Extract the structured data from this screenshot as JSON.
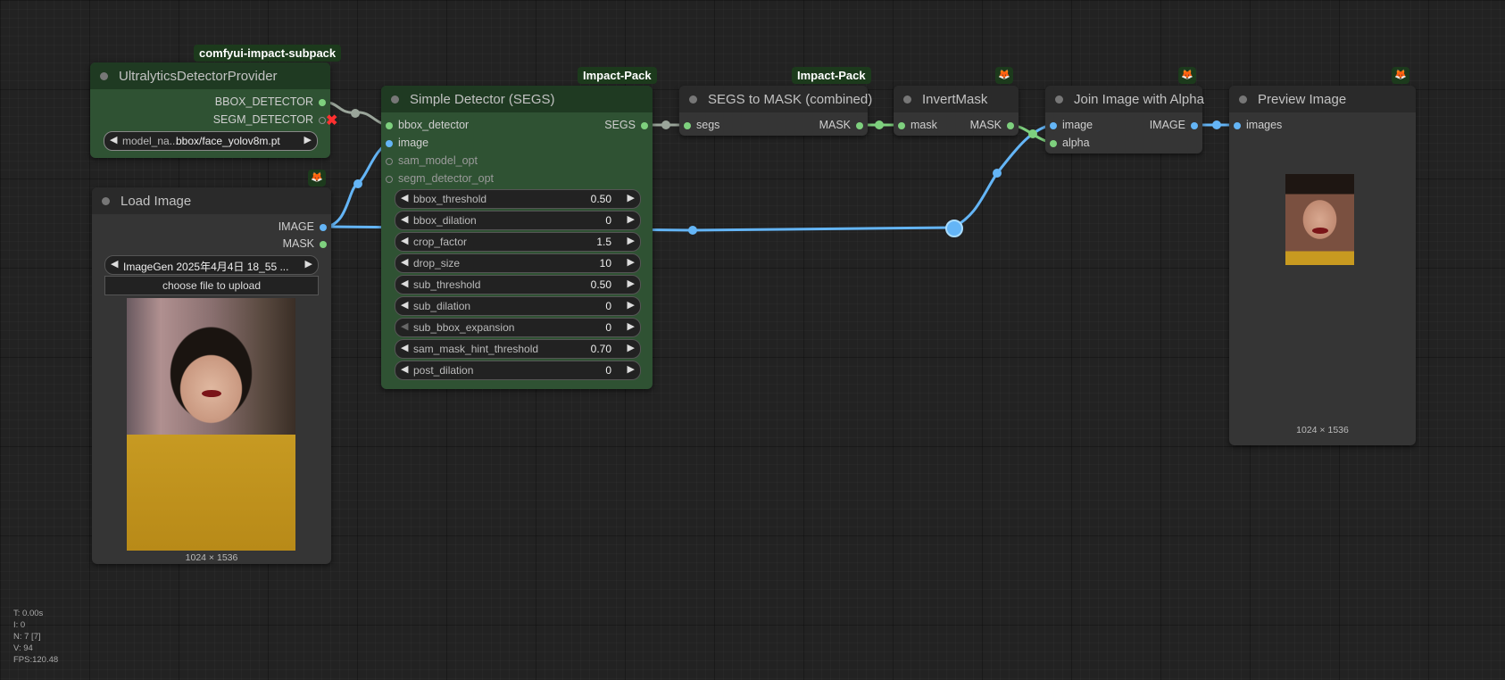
{
  "nodes": {
    "ultralytics": {
      "badge": "comfyui-impact-subpack",
      "title": "UltralyticsDetectorProvider",
      "outputs": [
        "BBOX_DETECTOR",
        "SEGM_DETECTOR"
      ],
      "widget_name": "model_na...",
      "widget_value": "bbox/face_yolov8m.pt",
      "segm_disconnected_icon": "red-x-icon"
    },
    "load_image": {
      "badge_icon": "fox-icon",
      "title": "Load Image",
      "outputs": [
        "IMAGE",
        "MASK"
      ],
      "file_value": "ImageGen 2025年4月4日 18_55 ...",
      "upload_label": "choose file to upload",
      "image_size": "1024 × 1536"
    },
    "simple_detector": {
      "badge": "Impact-Pack",
      "title": "Simple Detector (SEGS)",
      "inputs": [
        "bbox_detector",
        "image",
        "sam_model_opt",
        "segm_detector_opt"
      ],
      "outputs": [
        "SEGS"
      ],
      "widgets": [
        {
          "name": "bbox_threshold",
          "value": "0.50"
        },
        {
          "name": "bbox_dilation",
          "value": "0"
        },
        {
          "name": "crop_factor",
          "value": "1.5"
        },
        {
          "name": "drop_size",
          "value": "10"
        },
        {
          "name": "sub_threshold",
          "value": "0.50"
        },
        {
          "name": "sub_dilation",
          "value": "0"
        },
        {
          "name": "sub_bbox_expansion",
          "value": "0"
        },
        {
          "name": "sam_mask_hint_threshold",
          "value": "0.70"
        },
        {
          "name": "post_dilation",
          "value": "0"
        }
      ]
    },
    "segs_to_mask": {
      "badge": "Impact-Pack",
      "title": "SEGS to MASK (combined)",
      "inputs": [
        "segs"
      ],
      "outputs": [
        "MASK"
      ]
    },
    "invert_mask": {
      "badge_icon": "fox-icon",
      "title": "InvertMask",
      "inputs": [
        "mask"
      ],
      "outputs": [
        "MASK"
      ]
    },
    "join_alpha": {
      "badge_icon": "fox-icon",
      "title": "Join Image with Alpha",
      "inputs": [
        "image",
        "alpha"
      ],
      "outputs": [
        "IMAGE"
      ]
    },
    "preview": {
      "badge_icon": "fox-icon",
      "title": "Preview Image",
      "inputs": [
        "images"
      ],
      "image_size": "1024 × 1536"
    }
  },
  "hud": {
    "t": "T: 0.00s",
    "i": "I: 0",
    "n": "N: 7 [7]",
    "v": "V: 94",
    "fps": "FPS:120.48"
  },
  "colors": {
    "canvas": "#222222",
    "node_dark": "#353535",
    "node_green": "#2f5233",
    "badge_green": "#1c3a1c",
    "link_image": "#64b5f6",
    "link_mask": "#7ed07e",
    "link_detector": "#8a9a8a"
  }
}
